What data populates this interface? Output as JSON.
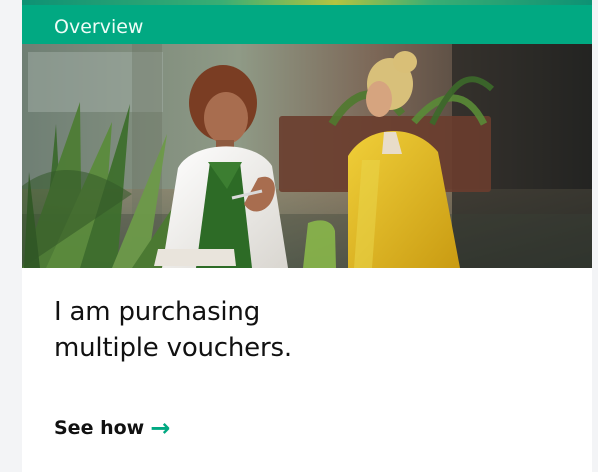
{
  "card": {
    "label": "Overview",
    "title": "I am purchasing multiple vouchers.",
    "cta": "See how",
    "cta_icon": "right-arrow-icon"
  },
  "image": {
    "subject": "meeting-photo"
  },
  "colors": {
    "accent": "#01a982",
    "background": "#f3f4f6",
    "card": "#ffffff",
    "text": "#111111"
  }
}
